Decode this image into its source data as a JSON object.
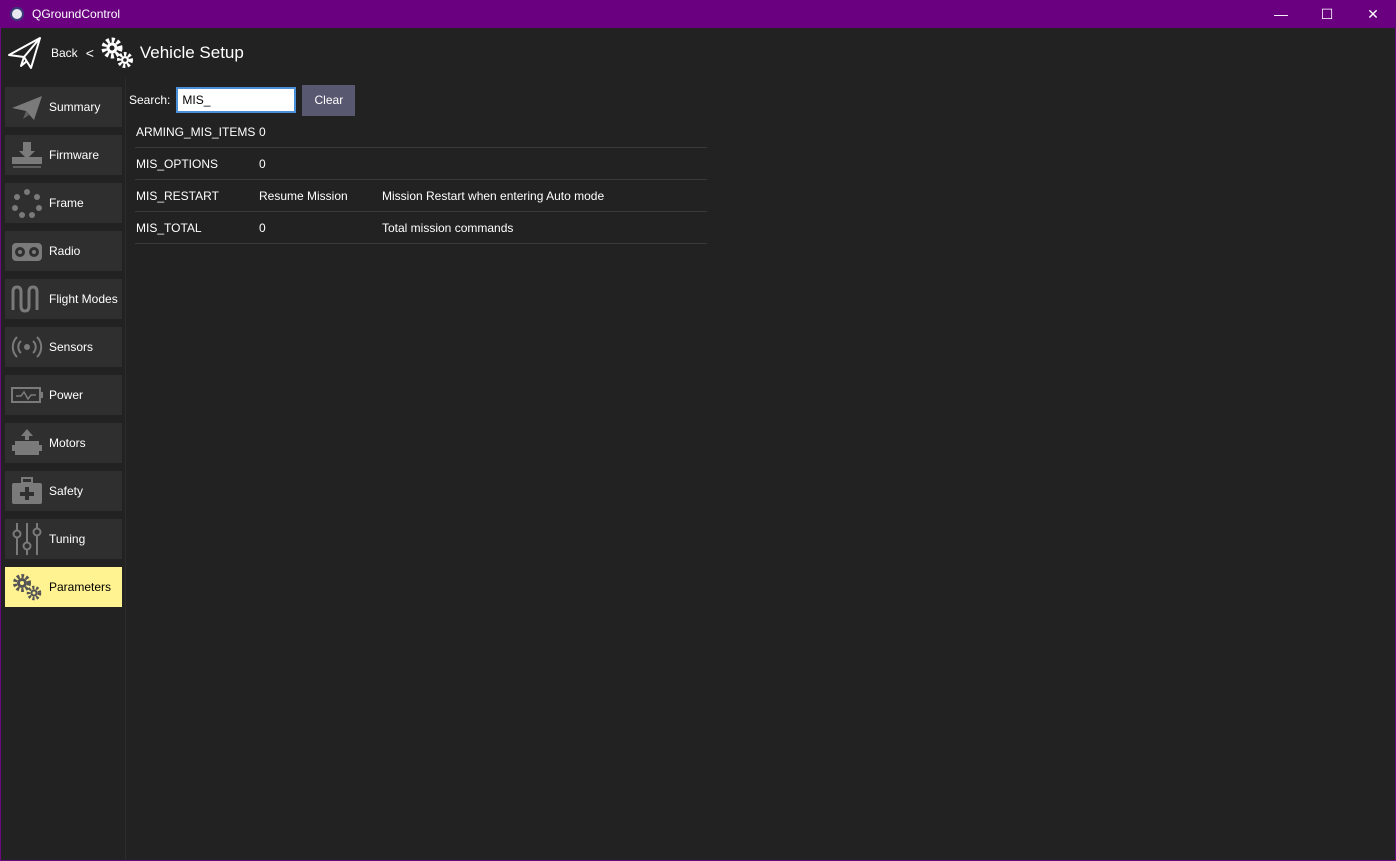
{
  "window": {
    "title": "QGroundControl",
    "controls": {
      "minimize": "—",
      "maximize": "☐",
      "close": "✕"
    }
  },
  "toolbar": {
    "back_label": "Back",
    "separator": "<",
    "page_title": "Vehicle Setup"
  },
  "sidebar": {
    "items": [
      {
        "label": "Summary",
        "icon": "paper-plane-icon",
        "active": false
      },
      {
        "label": "Firmware",
        "icon": "download-icon",
        "active": false
      },
      {
        "label": "Frame",
        "icon": "frame-dots-icon",
        "active": false
      },
      {
        "label": "Radio",
        "icon": "radio-transmitter-icon",
        "active": false
      },
      {
        "label": "Flight Modes",
        "icon": "wave-icon",
        "active": false
      },
      {
        "label": "Sensors",
        "icon": "sensor-signal-icon",
        "active": false
      },
      {
        "label": "Power",
        "icon": "battery-icon",
        "active": false
      },
      {
        "label": "Motors",
        "icon": "motor-icon",
        "active": false
      },
      {
        "label": "Safety",
        "icon": "first-aid-kit-icon",
        "active": false
      },
      {
        "label": "Tuning",
        "icon": "sliders-icon",
        "active": false
      },
      {
        "label": "Parameters",
        "icon": "gears-icon",
        "active": true
      }
    ]
  },
  "search": {
    "label": "Search:",
    "value": "MIS_",
    "clear_label": "Clear"
  },
  "parameters": [
    {
      "name": "ARMING_MIS_ITEMS",
      "value": "0",
      "description": ""
    },
    {
      "name": "MIS_OPTIONS",
      "value": "0",
      "description": ""
    },
    {
      "name": "MIS_RESTART",
      "value": "Resume Mission",
      "description": "Mission Restart when entering Auto mode"
    },
    {
      "name": "MIS_TOTAL",
      "value": "0",
      "description": "Total mission commands"
    }
  ],
  "colors": {
    "titlebar": "#6a0080",
    "background": "#222222",
    "nav_button": "#2f2f2f",
    "nav_active": "#fff291",
    "clear_button": "#585870",
    "icon_gray": "#7a7a7a"
  }
}
